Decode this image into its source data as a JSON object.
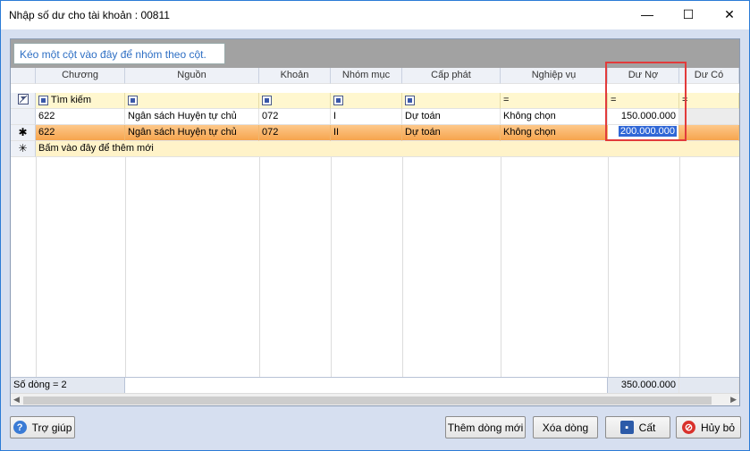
{
  "window": {
    "title": "Nhập số dư cho tài khoản : 00811",
    "minimize": "—",
    "maximize": "☐",
    "close": "✕"
  },
  "group_panel": {
    "text": "Kéo một cột vào đây để nhóm theo cột."
  },
  "columns": [
    "Chương",
    "Nguồn",
    "Khoản",
    "Nhóm mục",
    "Cấp phát",
    "Nghiệp vụ",
    "Dư Nợ",
    "Dư Có"
  ],
  "filter_row": {
    "search_label": "Tìm kiếm",
    "eq": "="
  },
  "rows": [
    {
      "chuong": "622",
      "nguon": "Ngân sách Huyện tự chủ",
      "khoan": "072",
      "nhom_muc": "I",
      "cap_phat": "Dự toán",
      "nghiep_vu": "Không chọn",
      "du_no": "150.000.000",
      "du_co": ""
    },
    {
      "chuong": "622",
      "nguon": "Ngân sách Huyện tự chủ",
      "khoan": "072",
      "nhom_muc": "II",
      "cap_phat": "Dự toán",
      "nghiep_vu": "Không chọn",
      "du_no": "200.000.000",
      "du_co": ""
    }
  ],
  "new_row": {
    "text": "Bấm vào đây để thêm mới"
  },
  "footer": {
    "row_count": "Số dòng = 2",
    "total_du_no": "350.000.000"
  },
  "buttons": {
    "help": "Trợ giúp",
    "add_row": "Thêm dòng mới",
    "delete_row": "Xóa dòng",
    "save": "Cất",
    "cancel": "Hủy bỏ"
  },
  "colors": {
    "accent": "#2e6fc4",
    "selected_row": "#f6a24a",
    "filter_row": "#fff7cf",
    "highlight_box": "#e23b3b"
  }
}
